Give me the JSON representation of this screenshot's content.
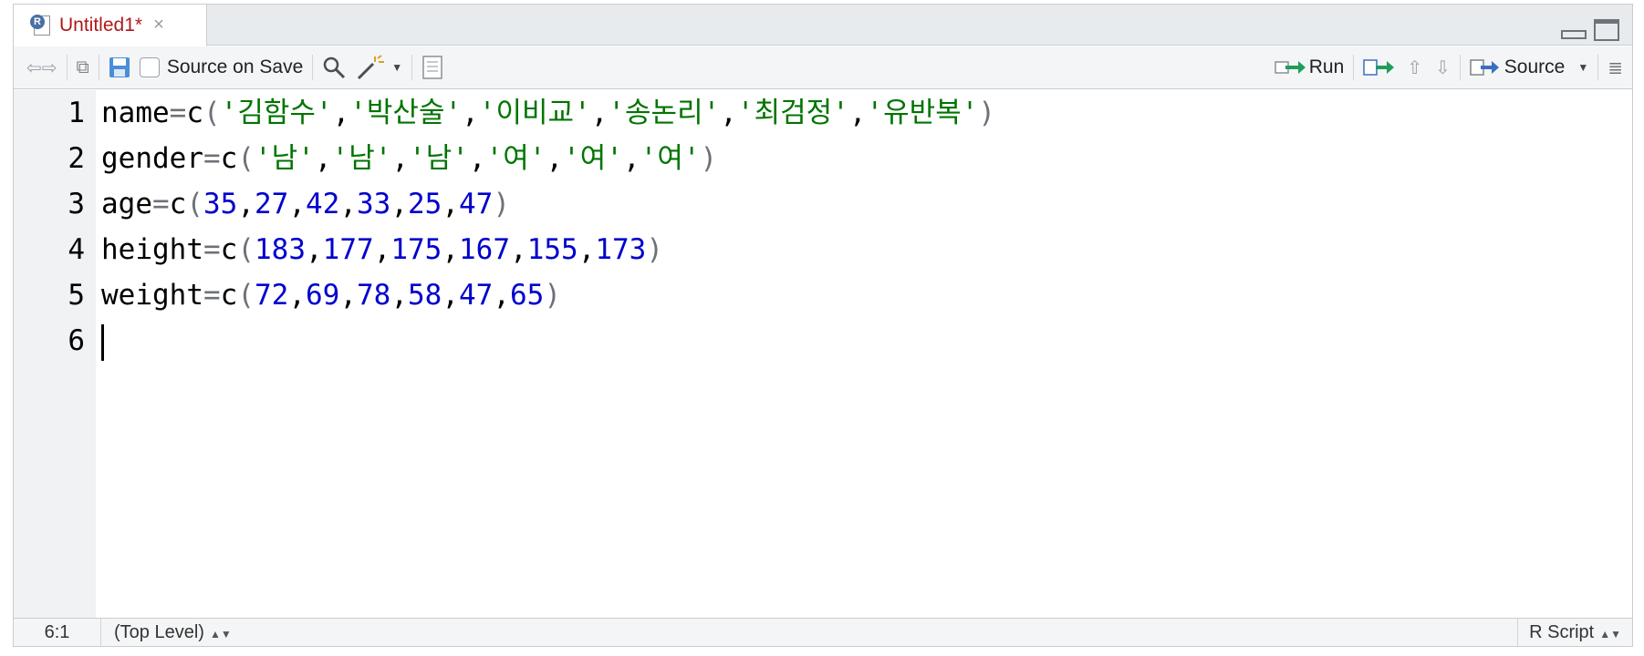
{
  "tab": {
    "title": "Untitled1*",
    "close": "×",
    "icon": "r-file-icon"
  },
  "toolbar": {
    "source_on_save": "Source on Save",
    "run": "Run",
    "source": "Source"
  },
  "code": [
    {
      "n": "1",
      "tokens": [
        [
          "id",
          "name"
        ],
        [
          "op",
          "="
        ],
        [
          "id",
          "c"
        ],
        [
          "op",
          "("
        ],
        [
          "str",
          "'김함수'"
        ],
        [
          "id",
          ","
        ],
        [
          "str",
          "'박산술'"
        ],
        [
          "id",
          ","
        ],
        [
          "str",
          "'이비교'"
        ],
        [
          "id",
          ","
        ],
        [
          "str",
          "'송논리'"
        ],
        [
          "id",
          ","
        ],
        [
          "str",
          "'최검정'"
        ],
        [
          "id",
          ","
        ],
        [
          "str",
          "'유반복'"
        ],
        [
          "op",
          ")"
        ]
      ]
    },
    {
      "n": "2",
      "tokens": [
        [
          "id",
          "gender"
        ],
        [
          "op",
          "="
        ],
        [
          "id",
          "c"
        ],
        [
          "op",
          "("
        ],
        [
          "str",
          "'남'"
        ],
        [
          "id",
          ","
        ],
        [
          "str",
          "'남'"
        ],
        [
          "id",
          ","
        ],
        [
          "str",
          "'남'"
        ],
        [
          "id",
          ","
        ],
        [
          "str",
          "'여'"
        ],
        [
          "id",
          ","
        ],
        [
          "str",
          "'여'"
        ],
        [
          "id",
          ","
        ],
        [
          "str",
          "'여'"
        ],
        [
          "op",
          ")"
        ]
      ]
    },
    {
      "n": "3",
      "tokens": [
        [
          "id",
          "age"
        ],
        [
          "op",
          "="
        ],
        [
          "id",
          "c"
        ],
        [
          "op",
          "("
        ],
        [
          "num",
          "35"
        ],
        [
          "id",
          ","
        ],
        [
          "num",
          "27"
        ],
        [
          "id",
          ","
        ],
        [
          "num",
          "42"
        ],
        [
          "id",
          ","
        ],
        [
          "num",
          "33"
        ],
        [
          "id",
          ","
        ],
        [
          "num",
          "25"
        ],
        [
          "id",
          ","
        ],
        [
          "num",
          "47"
        ],
        [
          "op",
          ")"
        ]
      ]
    },
    {
      "n": "4",
      "tokens": [
        [
          "id",
          "height"
        ],
        [
          "op",
          "="
        ],
        [
          "id",
          "c"
        ],
        [
          "op",
          "("
        ],
        [
          "num",
          "183"
        ],
        [
          "id",
          ","
        ],
        [
          "num",
          "177"
        ],
        [
          "id",
          ","
        ],
        [
          "num",
          "175"
        ],
        [
          "id",
          ","
        ],
        [
          "num",
          "167"
        ],
        [
          "id",
          ","
        ],
        [
          "num",
          "155"
        ],
        [
          "id",
          ","
        ],
        [
          "num",
          "173"
        ],
        [
          "op",
          ")"
        ]
      ]
    },
    {
      "n": "5",
      "tokens": [
        [
          "id",
          "weight"
        ],
        [
          "op",
          "="
        ],
        [
          "id",
          "c"
        ],
        [
          "op",
          "("
        ],
        [
          "num",
          "72"
        ],
        [
          "id",
          ","
        ],
        [
          "num",
          "69"
        ],
        [
          "id",
          ","
        ],
        [
          "num",
          "78"
        ],
        [
          "id",
          ","
        ],
        [
          "num",
          "58"
        ],
        [
          "id",
          ","
        ],
        [
          "num",
          "47"
        ],
        [
          "id",
          ","
        ],
        [
          "num",
          "65"
        ],
        [
          "op",
          ")"
        ]
      ]
    },
    {
      "n": "6",
      "tokens": [],
      "cursor": true
    }
  ],
  "status": {
    "position": "6:1",
    "scope": "(Top Level)",
    "language": "R Script"
  },
  "colors": {
    "string": "#007400",
    "number": "#0000cd",
    "tab_title": "#b01919"
  }
}
